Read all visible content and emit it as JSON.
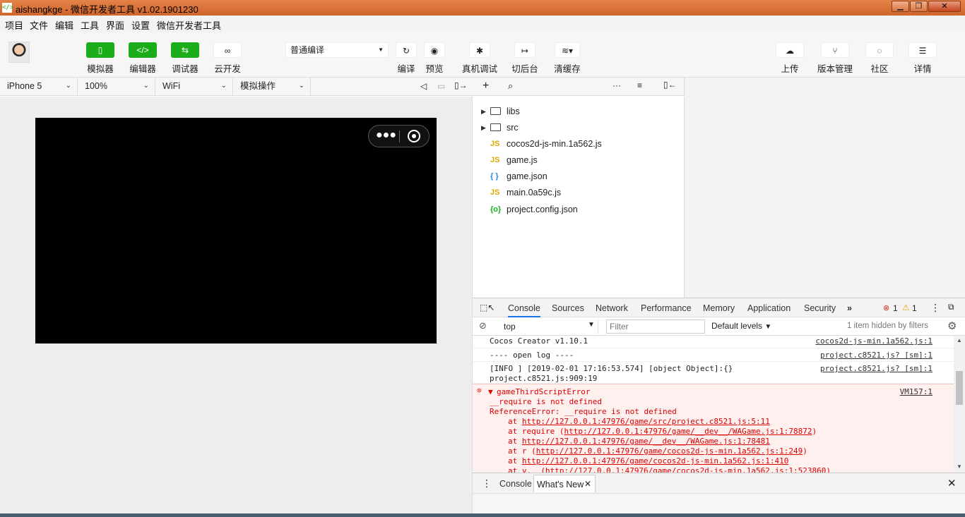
{
  "window": {
    "title": "aishangkge - 微信开发者工具 v1.02.1901230",
    "min": "▁",
    "max": "❐",
    "close": "✕"
  },
  "menu": [
    "项目",
    "文件",
    "编辑",
    "工具",
    "界面",
    "设置",
    "微信开发者工具"
  ],
  "toolbar": {
    "simulator": "模拟器",
    "editor": "编辑器",
    "debugger": "调试器",
    "cloud": "云开发",
    "compile_mode": "普通编译",
    "compile": "编译",
    "preview": "预览",
    "remote_debug": "真机调试",
    "background": "切后台",
    "clear_cache": "清缓存",
    "upload": "上传",
    "version": "版本管理",
    "community": "社区",
    "details": "详情"
  },
  "simbar": {
    "device": "iPhone 5",
    "zoom": "100%",
    "network": "WiFi",
    "operation": "模拟操作"
  },
  "files": [
    {
      "name": "libs",
      "type": "folder"
    },
    {
      "name": "src",
      "type": "folder"
    },
    {
      "name": "cocos2d-js-min.1a562.js",
      "type": "js"
    },
    {
      "name": "game.js",
      "type": "js"
    },
    {
      "name": "game.json",
      "type": "json"
    },
    {
      "name": "main.0a59c.js",
      "type": "js"
    },
    {
      "name": "project.config.json",
      "type": "config"
    }
  ],
  "devtools": {
    "tabs": [
      "Console",
      "Sources",
      "Network",
      "Performance",
      "Memory",
      "Application",
      "Security"
    ],
    "more": "»",
    "errors": "1",
    "warnings": "1",
    "context": "top",
    "filter_placeholder": "Filter",
    "levels": "Default levels",
    "hidden": "1 item hidden by filters"
  },
  "console": {
    "lines": [
      {
        "msg": "Cocos Creator v1.10.1",
        "src": "cocos2d-js-min.1a562.js:1"
      },
      {
        "msg": "---- open log ----",
        "src": "project.c8521.js? [sm]:1"
      },
      {
        "msg": "[INFO ] [2019-02-01 17:16:53.574] [object Object]:{}",
        "msg2": "project.c8521.js:909:19",
        "src": "project.c8521.js? [sm]:1"
      }
    ],
    "error": {
      "title": "gameThirdScriptError",
      "src": "VM157:1",
      "line1": "__require is not defined",
      "line2": "ReferenceError: __require is not defined",
      "stack": [
        {
          "pre": "at ",
          "url": "http://127.0.0.1:47976/game/src/project.c8521.js:5:11",
          "post": ""
        },
        {
          "pre": "at require (",
          "url": "http://127.0.0.1:47976/game/__dev__/WAGame.js:1:78872",
          "post": ")"
        },
        {
          "pre": "at ",
          "url": "http://127.0.0.1:47976/game/__dev__/WAGame.js:1:78481",
          "post": ""
        },
        {
          "pre": "at r (",
          "url": "http://127.0.0.1:47976/game/cocos2d-js-min.1a562.js:1:249",
          "post": ")"
        },
        {
          "pre": "at ",
          "url": "http://127.0.0.1:47976/game/cocos2d-js-min.1a562.js:1:410",
          "post": ""
        },
        {
          "pre": "at v._ (",
          "url": "http://127.0.0.1:47976/game/cocos2d-js-min.1a562.js:1:523860",
          "post": ")"
        }
      ]
    }
  },
  "drawer": {
    "tab1": "Console",
    "tab2": "What's New"
  }
}
